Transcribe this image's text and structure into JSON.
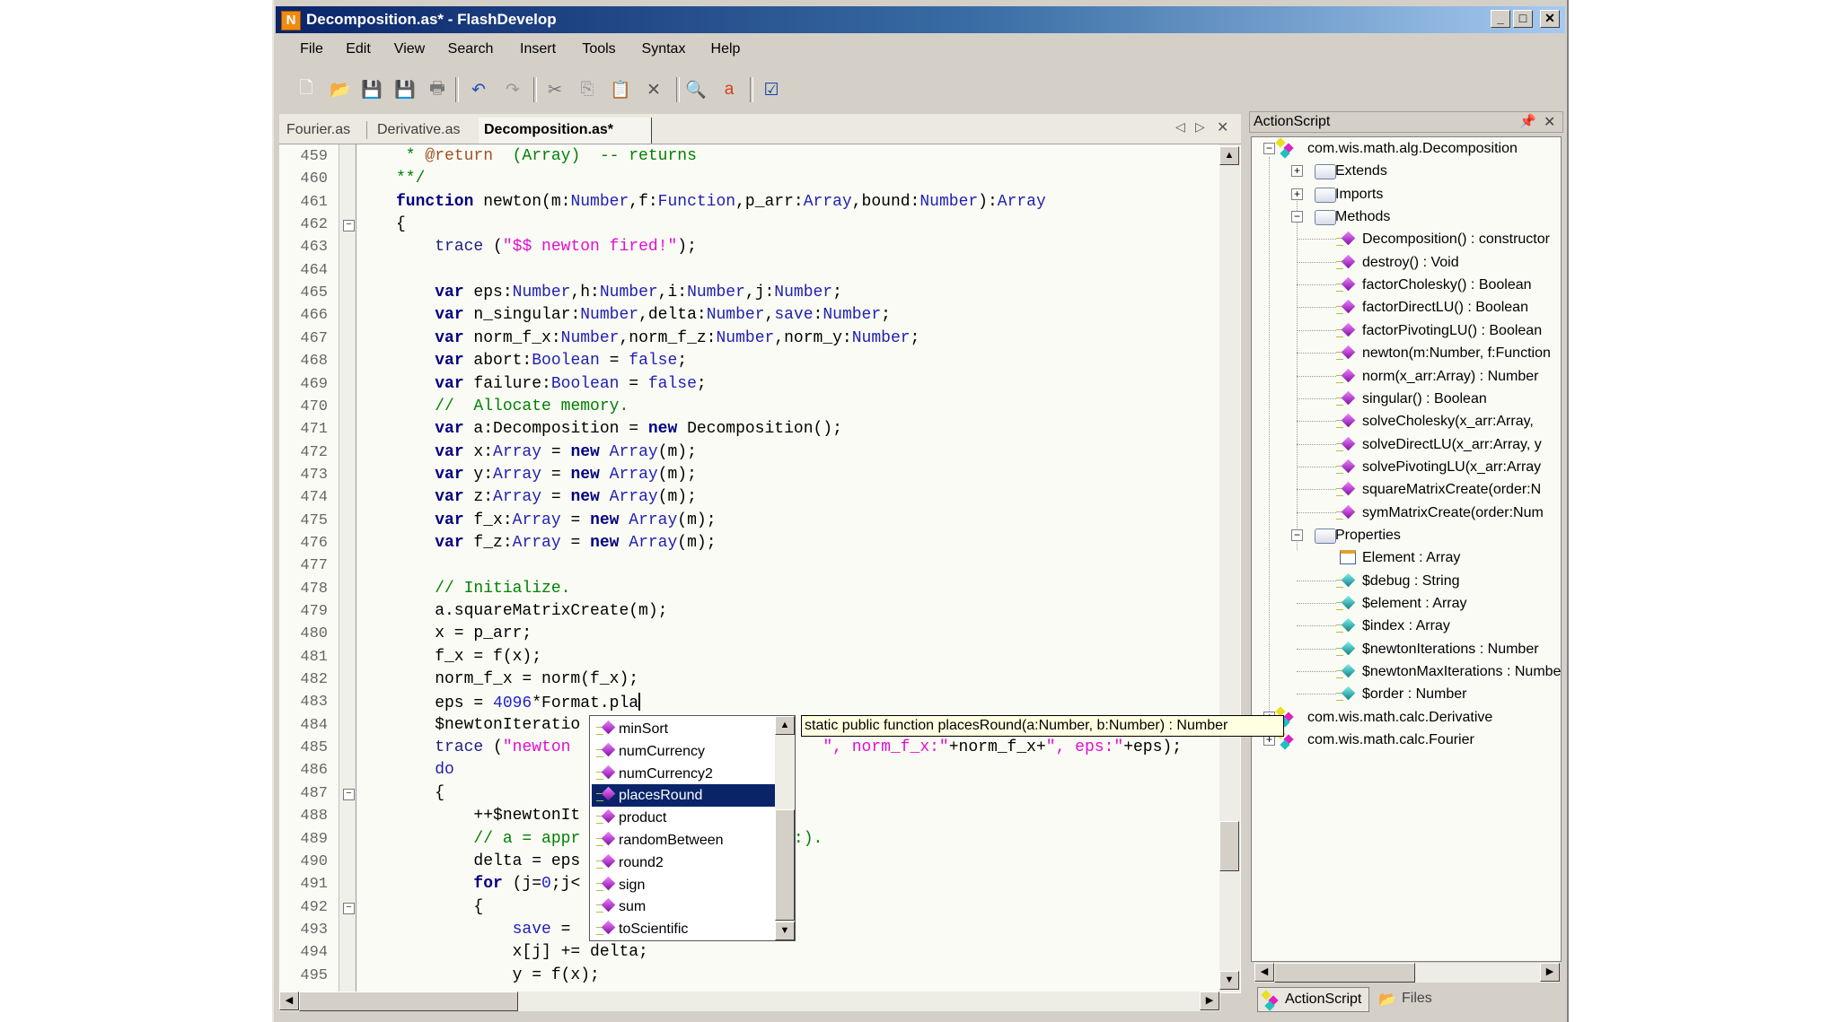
{
  "window": {
    "title": "Decomposition.as* - FlashDevelop",
    "app_icon": "flashdevelop-logo",
    "title_buttons": [
      "_",
      "□",
      "✕"
    ]
  },
  "menu": [
    "File",
    "Edit",
    "View",
    "Search",
    "Insert",
    "Tools",
    "Syntax",
    "Help"
  ],
  "toolbar": [
    {
      "name": "new-file",
      "glyph": "🗋"
    },
    {
      "name": "open-file",
      "glyph": "📂"
    },
    {
      "name": "save",
      "glyph": "💾"
    },
    {
      "name": "save-all",
      "glyph": "💾"
    },
    {
      "name": "print",
      "glyph": "🖶"
    },
    {
      "name": "undo",
      "glyph": "↶"
    },
    {
      "name": "redo",
      "glyph": "↷"
    },
    {
      "name": "cut",
      "glyph": "✂"
    },
    {
      "name": "copy",
      "glyph": "⎘"
    },
    {
      "name": "paste",
      "glyph": "📋"
    },
    {
      "name": "delete",
      "glyph": "✕"
    },
    {
      "name": "find",
      "glyph": "🔍"
    },
    {
      "name": "replace",
      "glyph": "a"
    },
    {
      "name": "check-syntax",
      "glyph": "☑"
    }
  ],
  "tabs": [
    {
      "label": "Fourier.as",
      "active": false
    },
    {
      "label": "Derivative.as",
      "active": false
    },
    {
      "label": "Decomposition.as*",
      "active": true
    }
  ],
  "tab_nav": {
    "prev": "◁",
    "next": "▷",
    "close": "✕"
  },
  "code": {
    "lines": [
      {
        "n": "459",
        "t": [
          [
            "c",
            " * "
          ],
          [
            "d",
            "@return"
          ],
          [
            "c",
            "  (Array)  -- returns"
          ]
        ]
      },
      {
        "n": "460",
        "t": [
          [
            "c",
            "**/"
          ]
        ]
      },
      {
        "n": "461",
        "t": [
          [
            "k",
            "function"
          ],
          [
            "p",
            " newton(m:"
          ],
          [
            "t",
            "Number"
          ],
          [
            "p",
            ",f:"
          ],
          [
            "t",
            "Function"
          ],
          [
            "p",
            ",p_arr:"
          ],
          [
            "t",
            "Array"
          ],
          [
            "p",
            ",bound:"
          ],
          [
            "t",
            "Number"
          ],
          [
            "p",
            "):"
          ],
          [
            "t",
            "Array"
          ]
        ]
      },
      {
        "n": "462",
        "fold": true,
        "t": [
          [
            "p",
            "{"
          ]
        ]
      },
      {
        "n": "463",
        "t": [
          [
            "p",
            "    "
          ],
          [
            "f",
            "trace"
          ],
          [
            "p",
            " ("
          ],
          [
            "s",
            "\"$$ newton fired!\""
          ],
          [
            "p",
            ");"
          ]
        ]
      },
      {
        "n": "464",
        "t": []
      },
      {
        "n": "465",
        "t": [
          [
            "p",
            "    "
          ],
          [
            "k",
            "var"
          ],
          [
            "p",
            " eps:"
          ],
          [
            "t",
            "Number"
          ],
          [
            "p",
            ",h:"
          ],
          [
            "t",
            "Number"
          ],
          [
            "p",
            ",i:"
          ],
          [
            "t",
            "Number"
          ],
          [
            "p",
            ",j:"
          ],
          [
            "t",
            "Number"
          ],
          [
            "p",
            ";"
          ]
        ]
      },
      {
        "n": "466",
        "t": [
          [
            "p",
            "    "
          ],
          [
            "k",
            "var"
          ],
          [
            "p",
            " n_singular:"
          ],
          [
            "t",
            "Number"
          ],
          [
            "p",
            ",delta:"
          ],
          [
            "t",
            "Number"
          ],
          [
            "p",
            ","
          ],
          [
            "t",
            "save"
          ],
          [
            "p",
            ":"
          ],
          [
            "t",
            "Number"
          ],
          [
            "p",
            ";"
          ]
        ]
      },
      {
        "n": "467",
        "t": [
          [
            "p",
            "    "
          ],
          [
            "k",
            "var"
          ],
          [
            "p",
            " norm_f_x:"
          ],
          [
            "t",
            "Number"
          ],
          [
            "p",
            ",norm_f_z:"
          ],
          [
            "t",
            "Number"
          ],
          [
            "p",
            ",norm_y:"
          ],
          [
            "t",
            "Number"
          ],
          [
            "p",
            ";"
          ]
        ]
      },
      {
        "n": "468",
        "t": [
          [
            "p",
            "    "
          ],
          [
            "k",
            "var"
          ],
          [
            "p",
            " abort:"
          ],
          [
            "t",
            "Boolean"
          ],
          [
            "p",
            " = "
          ],
          [
            "t",
            "false"
          ],
          [
            "p",
            ";"
          ]
        ]
      },
      {
        "n": "469",
        "t": [
          [
            "p",
            "    "
          ],
          [
            "k",
            "var"
          ],
          [
            "p",
            " failure:"
          ],
          [
            "t",
            "Boolean"
          ],
          [
            "p",
            " = "
          ],
          [
            "t",
            "false"
          ],
          [
            "p",
            ";"
          ]
        ]
      },
      {
        "n": "470",
        "t": [
          [
            "p",
            "    "
          ],
          [
            "c",
            "//  Allocate memory."
          ]
        ]
      },
      {
        "n": "471",
        "t": [
          [
            "p",
            "    "
          ],
          [
            "k",
            "var"
          ],
          [
            "p",
            " a:Decomposition = "
          ],
          [
            "k",
            "new"
          ],
          [
            "p",
            " Decomposition();"
          ]
        ]
      },
      {
        "n": "472",
        "t": [
          [
            "p",
            "    "
          ],
          [
            "k",
            "var"
          ],
          [
            "p",
            " x:"
          ],
          [
            "t",
            "Array"
          ],
          [
            "p",
            " = "
          ],
          [
            "k",
            "new"
          ],
          [
            "p",
            " "
          ],
          [
            "t",
            "Array"
          ],
          [
            "p",
            "(m);"
          ]
        ]
      },
      {
        "n": "473",
        "t": [
          [
            "p",
            "    "
          ],
          [
            "k",
            "var"
          ],
          [
            "p",
            " y:"
          ],
          [
            "t",
            "Array"
          ],
          [
            "p",
            " = "
          ],
          [
            "k",
            "new"
          ],
          [
            "p",
            " "
          ],
          [
            "t",
            "Array"
          ],
          [
            "p",
            "(m);"
          ]
        ]
      },
      {
        "n": "474",
        "t": [
          [
            "p",
            "    "
          ],
          [
            "k",
            "var"
          ],
          [
            "p",
            " z:"
          ],
          [
            "t",
            "Array"
          ],
          [
            "p",
            " = "
          ],
          [
            "k",
            "new"
          ],
          [
            "p",
            " "
          ],
          [
            "t",
            "Array"
          ],
          [
            "p",
            "(m);"
          ]
        ]
      },
      {
        "n": "475",
        "t": [
          [
            "p",
            "    "
          ],
          [
            "k",
            "var"
          ],
          [
            "p",
            " f_x:"
          ],
          [
            "t",
            "Array"
          ],
          [
            "p",
            " = "
          ],
          [
            "k",
            "new"
          ],
          [
            "p",
            " "
          ],
          [
            "t",
            "Array"
          ],
          [
            "p",
            "(m);"
          ]
        ]
      },
      {
        "n": "476",
        "t": [
          [
            "p",
            "    "
          ],
          [
            "k",
            "var"
          ],
          [
            "p",
            " f_z:"
          ],
          [
            "t",
            "Array"
          ],
          [
            "p",
            " = "
          ],
          [
            "k",
            "new"
          ],
          [
            "p",
            " "
          ],
          [
            "t",
            "Array"
          ],
          [
            "p",
            "(m);"
          ]
        ]
      },
      {
        "n": "477",
        "t": []
      },
      {
        "n": "478",
        "t": [
          [
            "p",
            "    "
          ],
          [
            "c",
            "// Initialize."
          ]
        ]
      },
      {
        "n": "479",
        "t": [
          [
            "p",
            "    a.squareMatrixCreate(m);"
          ]
        ]
      },
      {
        "n": "480",
        "t": [
          [
            "p",
            "    x = p_arr;"
          ]
        ]
      },
      {
        "n": "481",
        "t": [
          [
            "p",
            "    f_x = f(x);"
          ]
        ]
      },
      {
        "n": "482",
        "t": [
          [
            "p",
            "    norm_f_x = norm(f_x);"
          ]
        ]
      },
      {
        "n": "483",
        "caret": true,
        "t": [
          [
            "p",
            "    eps = "
          ],
          [
            "n",
            "4096"
          ],
          [
            "p",
            "*Format.pla"
          ]
        ]
      },
      {
        "n": "484",
        "t": [
          [
            "p",
            "    $newtonIteratio"
          ]
        ]
      },
      {
        "n": "485",
        "t": [
          [
            "p",
            "    "
          ],
          [
            "f",
            "trace"
          ],
          [
            "p",
            " ("
          ],
          [
            "s",
            "\"newton "
          ],
          [
            "p",
            "                         "
          ],
          [
            "s",
            "\", norm_f_x:\""
          ],
          [
            "p",
            "+norm_f_x+"
          ],
          [
            "s",
            "\", eps:\""
          ],
          [
            "p",
            "+eps);"
          ]
        ]
      },
      {
        "n": "486",
        "t": [
          [
            "p",
            "    "
          ],
          [
            "t",
            "do"
          ]
        ]
      },
      {
        "n": "487",
        "fold": true,
        "t": [
          [
            "p",
            "    {"
          ]
        ]
      },
      {
        "n": "488",
        "t": [
          [
            "p",
            "        ++$newtonIt"
          ]
        ]
      },
      {
        "n": "489",
        "t": [
          [
            "p",
            "        "
          ],
          [
            "c",
            "// a = appr"
          ],
          [
            "p",
            "                      "
          ],
          [
            "c",
            ":)."
          ]
        ]
      },
      {
        "n": "490",
        "t": [
          [
            "p",
            "        delta = eps"
          ]
        ]
      },
      {
        "n": "491",
        "t": [
          [
            "p",
            "        "
          ],
          [
            "k",
            "for"
          ],
          [
            "p",
            " (j="
          ],
          [
            "n",
            "0"
          ],
          [
            "p",
            ";j<"
          ]
        ]
      },
      {
        "n": "492",
        "fold": true,
        "t": [
          [
            "p",
            "        {"
          ]
        ]
      },
      {
        "n": "493",
        "t": [
          [
            "p",
            "            "
          ],
          [
            "t",
            "save"
          ],
          [
            "p",
            " = "
          ]
        ]
      },
      {
        "n": "494",
        "t": [
          [
            "p",
            "            x[j] += delta;"
          ]
        ]
      },
      {
        "n": "495",
        "t": [
          [
            "p",
            "            y = f(x);"
          ]
        ]
      }
    ]
  },
  "autocomplete": {
    "items": [
      "minSort",
      "numCurrency",
      "numCurrency2",
      "placesRound",
      "product",
      "randomBetween",
      "round2",
      "sign",
      "sum",
      "toScientific"
    ],
    "selected_index": 3,
    "tooltip": "static public function placesRound(a:Number, b:Number) : Number"
  },
  "panel": {
    "title": "ActionScript",
    "pin_icon": "pin-icon",
    "tree": [
      {
        "level": 0,
        "icon": "class",
        "exp": "−",
        "label": "com.wis.math.alg.Decomposition"
      },
      {
        "level": 1,
        "icon": "folder",
        "exp": "+",
        "label": "Extends"
      },
      {
        "level": 1,
        "icon": "folder",
        "exp": "+",
        "label": "Imports"
      },
      {
        "level": 1,
        "icon": "folder",
        "exp": "−",
        "label": "Methods"
      },
      {
        "level": 2,
        "icon": "method",
        "label": "Decomposition() : constructor"
      },
      {
        "level": 2,
        "icon": "method",
        "label": "destroy() : Void"
      },
      {
        "level": 2,
        "icon": "method",
        "label": "factorCholesky() : Boolean"
      },
      {
        "level": 2,
        "icon": "method",
        "label": "factorDirectLU() : Boolean"
      },
      {
        "level": 2,
        "icon": "method",
        "label": "factorPivotingLU() : Boolean"
      },
      {
        "level": 2,
        "icon": "method",
        "label": "newton(m:Number, f:Function"
      },
      {
        "level": 2,
        "icon": "method",
        "label": "norm(x_arr:Array) : Number"
      },
      {
        "level": 2,
        "icon": "method",
        "label": "singular() : Boolean"
      },
      {
        "level": 2,
        "icon": "method",
        "label": "solveCholesky(x_arr:Array,"
      },
      {
        "level": 2,
        "icon": "method",
        "label": "solveDirectLU(x_arr:Array, y"
      },
      {
        "level": 2,
        "icon": "method",
        "label": "solvePivotingLU(x_arr:Array"
      },
      {
        "level": 2,
        "icon": "method",
        "label": "squareMatrixCreate(order:N"
      },
      {
        "level": 2,
        "icon": "method",
        "label": "symMatrixCreate(order:Num"
      },
      {
        "level": 1,
        "icon": "folder",
        "exp": "−",
        "label": "Properties"
      },
      {
        "level": 2,
        "icon": "element",
        "label": "Element : Array"
      },
      {
        "level": 2,
        "icon": "property",
        "label": "$debug : String"
      },
      {
        "level": 2,
        "icon": "property",
        "label": "$element : Array"
      },
      {
        "level": 2,
        "icon": "property",
        "label": "$index : Array"
      },
      {
        "level": 2,
        "icon": "property",
        "label": "$newtonIterations : Number"
      },
      {
        "level": 2,
        "icon": "property",
        "label": "$newtonMaxIterations : Number"
      },
      {
        "level": 2,
        "icon": "property",
        "label": "$order : Number"
      },
      {
        "level": 0,
        "icon": "class",
        "exp": "+",
        "label": "com.wis.math.calc.Derivative"
      },
      {
        "level": 0,
        "icon": "class",
        "exp": "+",
        "label": "com.wis.math.calc.Fourier"
      }
    ],
    "bottom_tabs": [
      {
        "label": "ActionScript",
        "active": true
      },
      {
        "label": "Files",
        "active": false
      }
    ]
  },
  "colors": {
    "accent": "#0a246a",
    "keyword": "#000080",
    "type": "#2020b0",
    "comment": "#008000",
    "string": "#e010d0",
    "method_icon": "#a020c0",
    "property_icon": "#20a0a0"
  }
}
